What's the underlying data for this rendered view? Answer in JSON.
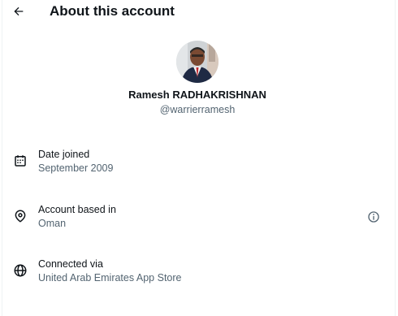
{
  "header": {
    "title": "About this account",
    "back_icon": "arrow-left-icon"
  },
  "profile": {
    "display_name": "Ramesh RADHAKRISHNAN",
    "handle": "@warrierramesh"
  },
  "details": [
    {
      "icon": "calendar-icon",
      "label": "Date joined",
      "value": "September 2009"
    },
    {
      "icon": "location-pin-icon",
      "label": "Account based in",
      "value": "Oman",
      "info_icon": "info-icon"
    },
    {
      "icon": "globe-icon",
      "label": "Connected via",
      "value": "United Arab Emirates App Store"
    }
  ],
  "colors": {
    "text_primary": "#0f1419",
    "text_secondary": "#536471",
    "divider": "#eff3f4"
  }
}
